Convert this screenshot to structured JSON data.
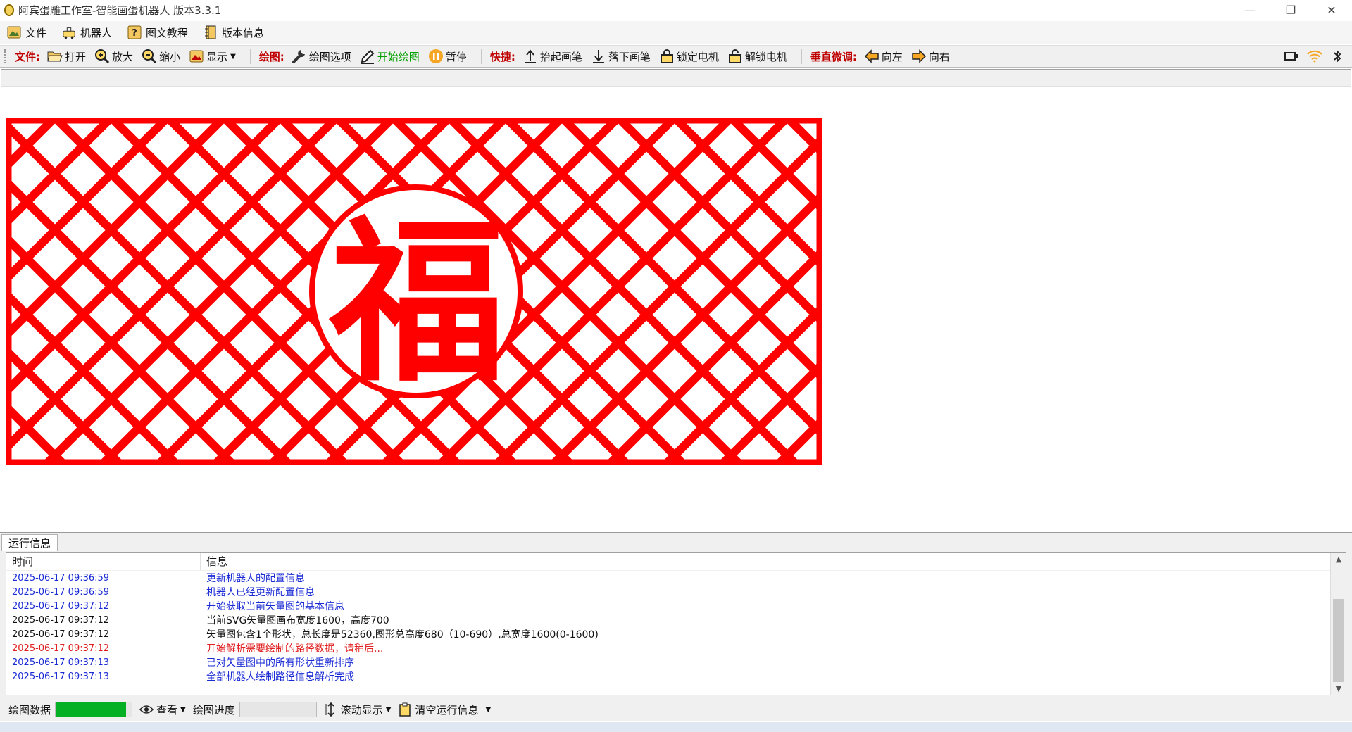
{
  "window": {
    "title": "阿宾蛋雕工作室-智能画蛋机器人 版本3.3.1",
    "minimize": "—",
    "maximize": "❐",
    "close": "✕"
  },
  "menu": {
    "items": [
      {
        "label": "文件",
        "icon": "picture-icon"
      },
      {
        "label": "机器人",
        "icon": "robot-icon"
      },
      {
        "label": "图文教程",
        "icon": "help-icon"
      },
      {
        "label": "版本信息",
        "icon": "book-icon"
      }
    ]
  },
  "toolbar": {
    "file_group": "文件:",
    "open": "打开",
    "zoom_in": "放大",
    "zoom_out": "缩小",
    "display": "显示",
    "draw_group": "绘图:",
    "draw_options": "绘图选项",
    "start_draw": "开始绘图",
    "pause": "暂停",
    "quick_group": "快捷:",
    "pen_up": "抬起画笔",
    "pen_down": "落下画笔",
    "lock_motor": "锁定电机",
    "unlock_motor": "解锁电机",
    "vertical_group": "垂直微调:",
    "left": "向左",
    "right": "向右"
  },
  "colors": {
    "accent_red": "#ff0000",
    "label_red": "#c00000",
    "progress_green": "#06b025"
  },
  "log": {
    "tab": "运行信息",
    "col_time": "时间",
    "col_msg": "信息",
    "rows": [
      {
        "time": "2025-06-17 09:36:59",
        "msg": "更新机器人的配置信息",
        "color": "blue"
      },
      {
        "time": "2025-06-17 09:36:59",
        "msg": "机器人已经更新配置信息",
        "color": "blue"
      },
      {
        "time": "2025-06-17 09:37:12",
        "msg": "开始获取当前矢量图的基本信息",
        "color": "blue"
      },
      {
        "time": "2025-06-17 09:37:12",
        "msg": "当前SVG矢量图画布宽度1600，高度700",
        "color": "black"
      },
      {
        "time": "2025-06-17 09:37:12",
        "msg": "矢量图包含1个形状，总长度是52360,图形总高度680（10-690）,总宽度1600(0-1600)",
        "color": "black"
      },
      {
        "time": "2025-06-17 09:37:12",
        "msg": "开始解析需要绘制的路径数据，请稍后...",
        "color": "red"
      },
      {
        "time": "2025-06-17 09:37:13",
        "msg": "已对矢量图中的所有形状重新排序",
        "color": "blue"
      },
      {
        "time": "2025-06-17 09:37:13",
        "msg": "全部机器人绘制路径信息解析完成",
        "color": "blue"
      }
    ]
  },
  "status": {
    "draw_data": "绘图数据",
    "draw_data_fill": 0.93,
    "view": "查看",
    "draw_progress": "绘图进度",
    "draw_progress_fill": 0,
    "scroll_display": "滚动显示",
    "clear_log": "清空运行信息"
  },
  "artwork": {
    "character": "福"
  }
}
